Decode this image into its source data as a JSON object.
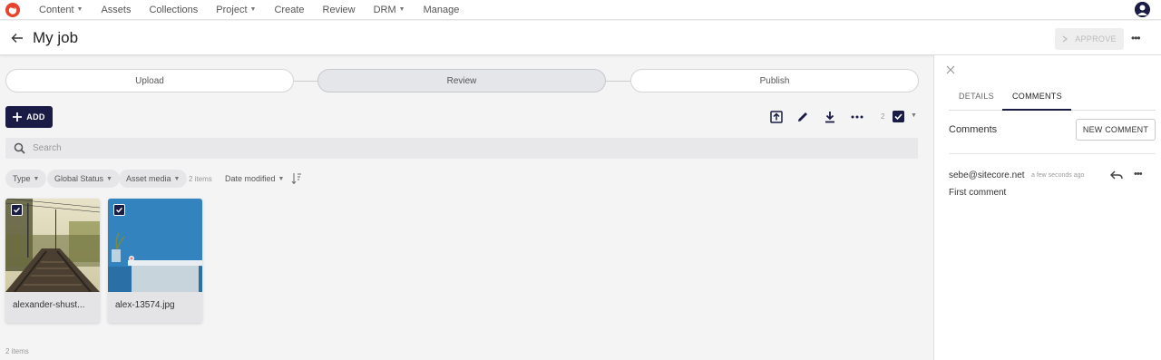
{
  "nav": {
    "items": [
      {
        "label": "Content",
        "dropdown": true
      },
      {
        "label": "Assets",
        "dropdown": false
      },
      {
        "label": "Collections",
        "dropdown": false
      },
      {
        "label": "Project",
        "dropdown": true
      },
      {
        "label": "Create",
        "dropdown": false
      },
      {
        "label": "Review",
        "dropdown": false
      },
      {
        "label": "DRM",
        "dropdown": true
      },
      {
        "label": "Manage",
        "dropdown": false
      }
    ]
  },
  "header": {
    "title": "My job",
    "approve_label": "APPROVE"
  },
  "steps": [
    {
      "label": "Upload",
      "active": false
    },
    {
      "label": "Review",
      "active": true
    },
    {
      "label": "Publish",
      "active": false
    }
  ],
  "toolbar": {
    "add_label": "ADD",
    "selected_count": "2"
  },
  "search": {
    "placeholder": "Search"
  },
  "filters": {
    "type": "Type",
    "global_status": "Global Status",
    "asset_media": "Asset media",
    "item_count": "2 items",
    "sort": "Date modified"
  },
  "assets": [
    {
      "name": "alexander-shust...",
      "selected": true
    },
    {
      "name": "alex-13574.jpg",
      "selected": true
    }
  ],
  "footer": {
    "count": "2 items"
  },
  "panel": {
    "tabs": [
      {
        "label": "DETAILS",
        "active": false
      },
      {
        "label": "COMMENTS",
        "active": true
      }
    ],
    "heading": "Comments",
    "new_comment_label": "NEW COMMENT",
    "comment": {
      "author": "sebe@sitecore.net",
      "time": "a few seconds ago",
      "text": "First comment"
    }
  },
  "colors": {
    "primary": "#1a1c46",
    "logo": "#e8412c"
  }
}
